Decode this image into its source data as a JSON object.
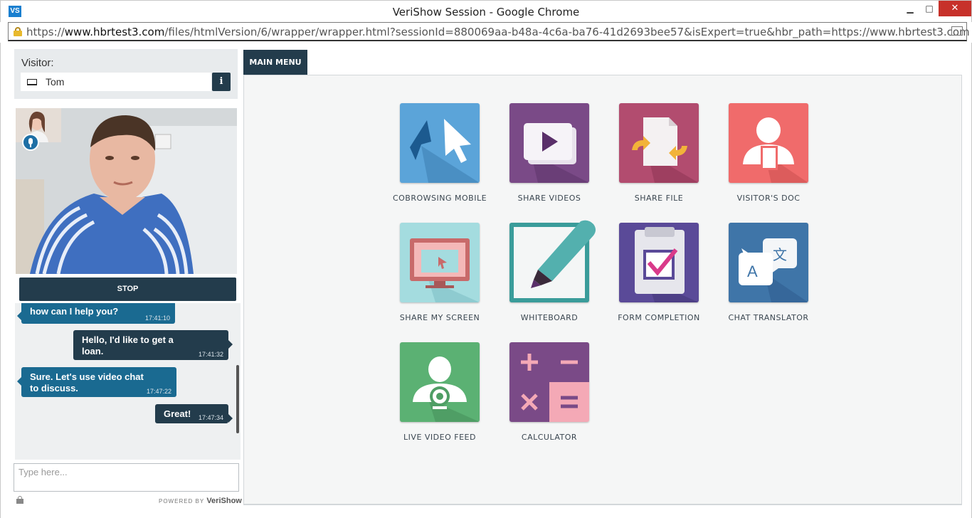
{
  "window": {
    "app_icon_text": "VS",
    "title": "VeriShow Session - Google Chrome",
    "minimize": "▁",
    "maximize": "□",
    "close": "✕"
  },
  "address": {
    "url_prefix": "https://",
    "url_host": "www.hbrtest3.com",
    "url_rest": "/files/htmlVersion/6/wrapper/wrapper.html?sessionId=880069aa-b48a-4c6a-ba76-41d2693bee57&isExpert=true&hbr_path=https://www.hbrtest3.com"
  },
  "visitor": {
    "label": "Visitor:",
    "name": "Tom",
    "info_label": "i"
  },
  "video": {
    "stop_label": "STOP"
  },
  "chat": {
    "messages": [
      {
        "text": "how can I help you?",
        "time": "17:41:10"
      },
      {
        "text": "Hello, I'd like to get a loan.",
        "time": "17:41:32"
      },
      {
        "text": "Sure. Let's use video chat to discuss.",
        "time": "17:47:22"
      },
      {
        "text": "Great!",
        "time": "17:47:34"
      }
    ],
    "input_placeholder": "Type here...",
    "powered_prefix": "POWERED BY",
    "powered_brand": "VeriShow"
  },
  "main_menu": {
    "tab_label": "MAIN MENU",
    "tiles": [
      {
        "label": "COBROWSING MOBILE",
        "icon": "cursor-arrows-icon",
        "color": "#5ba4d9"
      },
      {
        "label": "SHARE VIDEOS",
        "icon": "video-play-icon",
        "color": "#7a4a87"
      },
      {
        "label": "SHARE FILE",
        "icon": "file-share-icon",
        "color": "#b24c6f"
      },
      {
        "label": "VISITOR'S DOC",
        "icon": "visitor-doc-icon",
        "color": "#f06b6b"
      },
      {
        "label": "SHARE MY SCREEN",
        "icon": "monitor-icon",
        "color": "#a4dcdf"
      },
      {
        "label": "WHITEBOARD",
        "icon": "marker-icon",
        "color": "#3a9c9a"
      },
      {
        "label": "FORM COMPLETION",
        "icon": "checkbox-form-icon",
        "color": "#5a4a98"
      },
      {
        "label": "CHAT TRANSLATOR",
        "icon": "translate-icon",
        "color": "#3f75a8"
      },
      {
        "label": "LIVE VIDEO FEED",
        "icon": "webcam-person-icon",
        "color": "#5bb173"
      },
      {
        "label": "CALCULATOR",
        "icon": "calculator-icon",
        "color": "#7a4a87"
      }
    ]
  }
}
